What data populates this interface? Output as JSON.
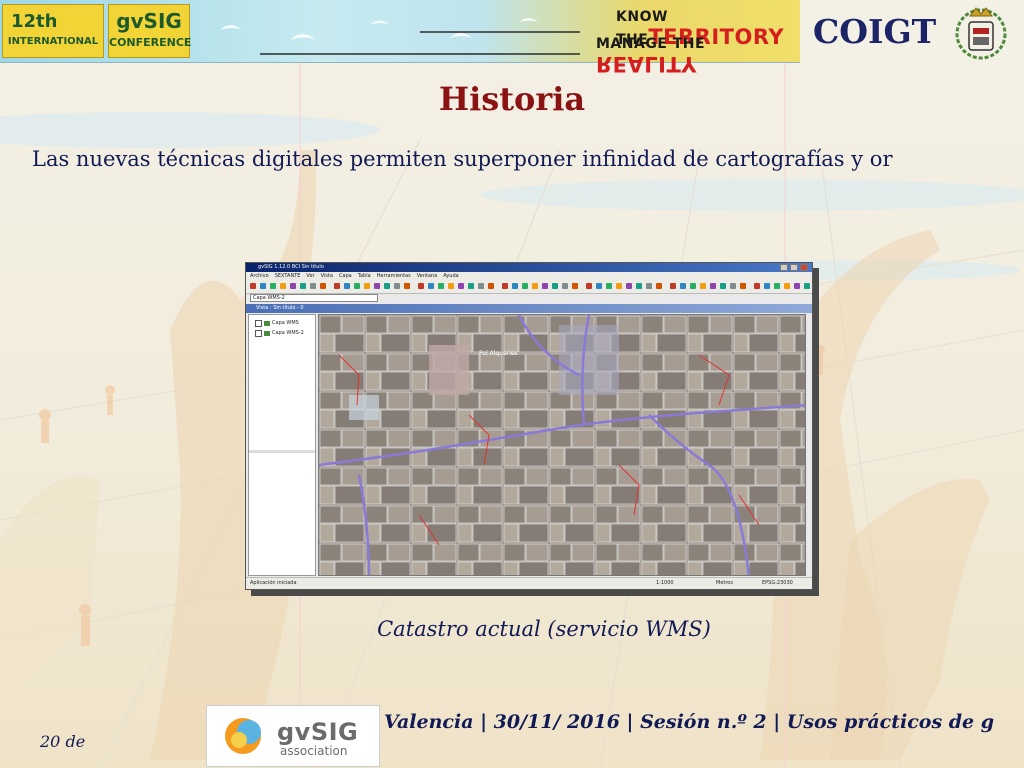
{
  "header": {
    "badge_12th_line1": "12th",
    "badge_12th_line2": "INTERNATIONAL",
    "badge_gvsig_line1": "gvSIG",
    "badge_gvsig_line2": "CONFERENCE",
    "know_prefix": "KNOW THE",
    "know_big": "TERRITORY",
    "manage_prefix": "MANAGE THE",
    "manage_big": "REALITY",
    "org_name": "COIGT",
    "crest_icon": "coat-of-arms-icon"
  },
  "slide": {
    "title": "Historia",
    "body": "Las nuevas técnicas digitales permiten superponer infinidad de cartografías y or",
    "caption": "Catastro actual (servicio WMS)"
  },
  "app_screenshot": {
    "window_title": "gvSIG 1.12.0 BCI Sin título",
    "menu": [
      "Archivo",
      "SEXTANTE",
      "Ver",
      "Vista",
      "Capa",
      "Tabla",
      "Herramientas",
      "Ventana",
      "Ayuda"
    ],
    "layer_combo_value": "Capa WMS-2",
    "view_title": "Vista : Sin título - 0",
    "layers": [
      {
        "name": "Capa WMS",
        "checked": true
      },
      {
        "name": "Capa WMS-2",
        "checked": true
      }
    ],
    "map_label": "Pol Alqueries",
    "status_message": "Aplicación iniciada",
    "scale": "1:1000",
    "units": "Metros",
    "crs": "EPSG:23030"
  },
  "footer": {
    "logo_word": "gvSIG",
    "logo_sub": "association",
    "text": "Valencia | 30/11/ 2016 | Sesión n.º 2 | Usos prácticos de g",
    "page_number": "20 de"
  },
  "colors": {
    "title": "#8b1212",
    "body_text": "#111a55",
    "coigt": "#1b2466",
    "banner_accent": "#d51f1f"
  }
}
